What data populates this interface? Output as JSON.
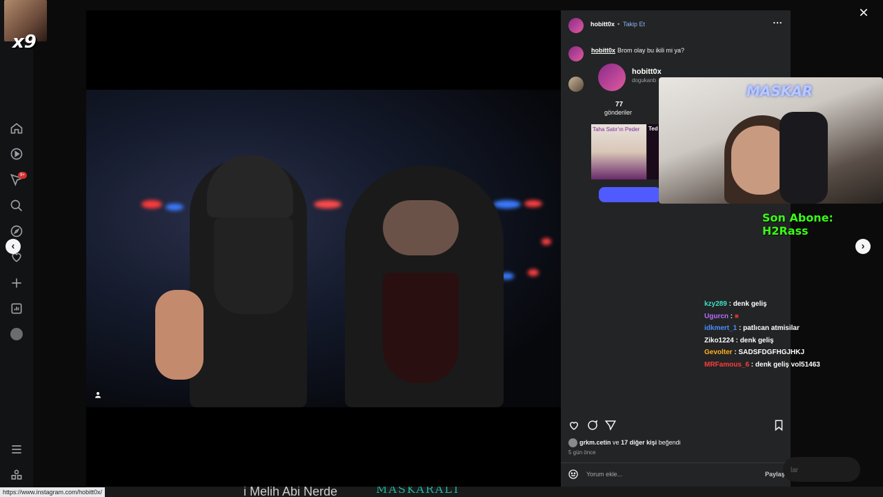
{
  "cam_label": "x9",
  "rail": {
    "notif_badge": "9+"
  },
  "post": {
    "author": "hobitt0x",
    "separator": "•",
    "follow": "Takip Et",
    "caption_user": "hobitt0x",
    "caption": "Brom olay bu ikili mi ya?",
    "preview": {
      "username": "hobitt0x",
      "handle": "dogukanb",
      "count": "77",
      "count_label": "gönderiler",
      "thumb1_label": "Taha Satır'ın Peder",
      "thumb2_label": "Ted"
    },
    "likes_user": "grkm.cetin",
    "likes_mid": "ve",
    "likes_rest": "17 diğer kişi",
    "likes_end": "beğendi",
    "time": "5 gün önce",
    "comment_placeholder": "Yorum ekle...",
    "share": "Paylaş"
  },
  "overlay": {
    "maskar": "MASKAR",
    "son_abone": "Son Abone: H2Rass",
    "chat": [
      {
        "user": "kzy289",
        "sep": " : ",
        "msg": "denk geliş",
        "color": "#3ee0c4"
      },
      {
        "user": "Ugurcn",
        "sep": " : ",
        "msg": "■",
        "color": "#b36cff"
      },
      {
        "user": "idkmert_1",
        "sep": " : ",
        "msg": "patlıcan atmisilar",
        "color": "#4a8cff"
      },
      {
        "user": "Ziko1224",
        "sep": " : ",
        "msg": "denk geliş",
        "color": "#ffffff"
      },
      {
        "user": "Gevolter",
        "sep": " : ",
        "msg": "SADSFDGFHGJHKJ",
        "color": "#ffb020"
      },
      {
        "user": "MRFamous_6",
        "sep": " : ",
        "msg": "denk geliş vol51463",
        "color": "#ff3b3b"
      }
    ]
  },
  "ghost_text": "lar",
  "bottom_strip": {
    "text1": "i Melih Abi Nerde",
    "text2": "MASKARALT"
  },
  "status_url": "https://www.instagram.com/hobitt0x/",
  "colors": {
    "panel": "#232425",
    "accent": "#4f5bff",
    "follow": "#8ab4f8",
    "son_abone": "#39ff14"
  }
}
